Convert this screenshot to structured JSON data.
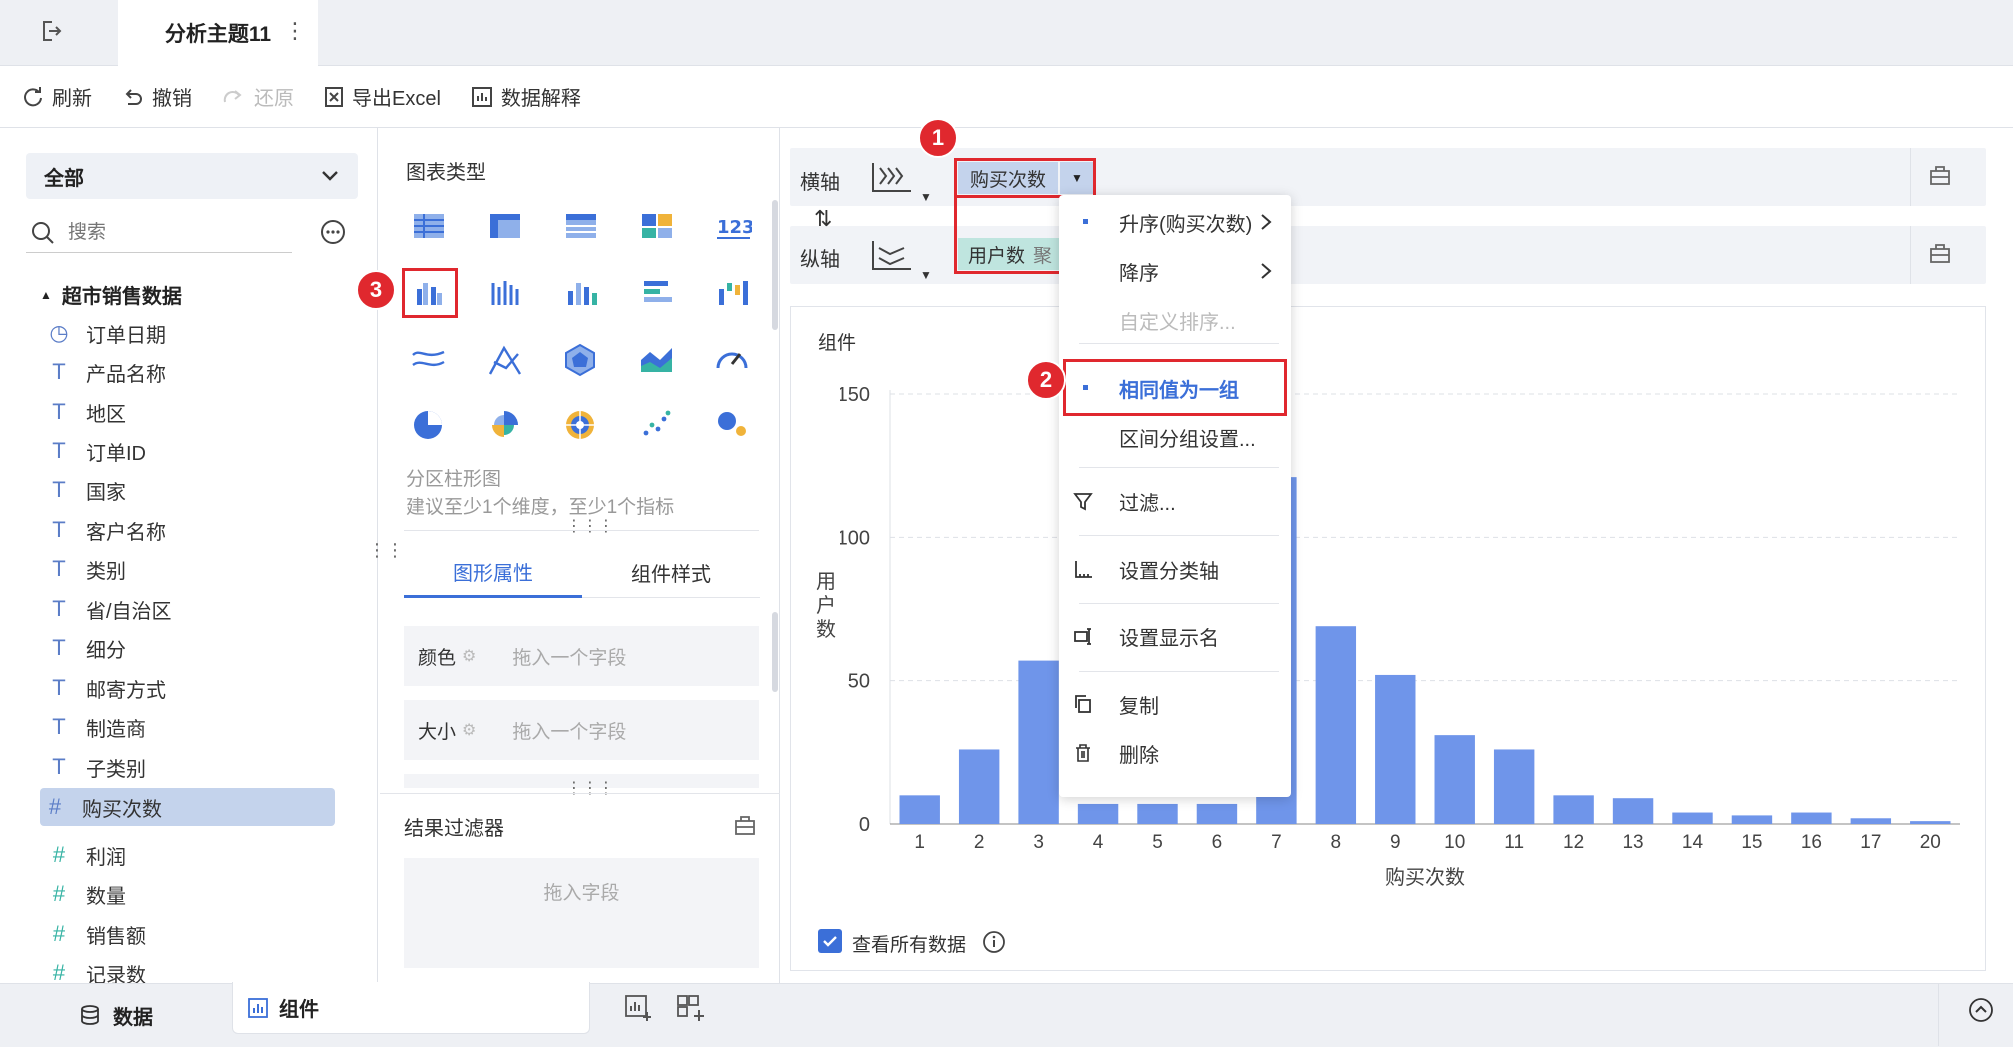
{
  "titlebar": {
    "tab_title": "分析主题11"
  },
  "toolbar": {
    "refresh": "刷新",
    "undo": "撤销",
    "redo": "还原",
    "export": "导出Excel",
    "explain": "数据解释"
  },
  "left": {
    "dataset_select": "全部",
    "search_placeholder": "搜索",
    "group_title": "超市销售数据",
    "fields": [
      {
        "label": "订单日期",
        "type": "date"
      },
      {
        "label": "产品名称",
        "type": "text"
      },
      {
        "label": "地区",
        "type": "text"
      },
      {
        "label": "订单ID",
        "type": "text"
      },
      {
        "label": "国家",
        "type": "text"
      },
      {
        "label": "客户名称",
        "type": "text"
      },
      {
        "label": "类别",
        "type": "text"
      },
      {
        "label": "省/自治区",
        "type": "text"
      },
      {
        "label": "细分",
        "type": "text"
      },
      {
        "label": "邮寄方式",
        "type": "text"
      },
      {
        "label": "制造商",
        "type": "text"
      },
      {
        "label": "子类别",
        "type": "text"
      },
      {
        "label": "购买次数",
        "type": "num-dim",
        "selected": true
      },
      {
        "label": "利润",
        "type": "num"
      },
      {
        "label": "数量",
        "type": "num"
      },
      {
        "label": "销售额",
        "type": "num"
      },
      {
        "label": "记录数",
        "type": "num"
      }
    ]
  },
  "middle": {
    "chart_types_title": "图表类型",
    "chart_hint_name": "分区柱形图",
    "chart_hint_desc": "建议至少1个维度，至少1个指标",
    "tabs": {
      "graph_props": "图形属性",
      "component_style": "组件样式"
    },
    "props": {
      "color": "颜色",
      "size": "大小",
      "drop_placeholder": "拖入一个字段"
    },
    "result_filter": "结果过滤器",
    "drop_field": "拖入字段"
  },
  "axis": {
    "x_label": "横轴",
    "y_label": "纵轴",
    "x_field": "购买次数",
    "y_field": "用户数",
    "y_field_suffix": "聚"
  },
  "menu": {
    "items": [
      "升序(购买次数)",
      "降序",
      "自定义排序...",
      "相同值为一组",
      "区间分组设置...",
      "过滤...",
      "设置分类轴",
      "设置显示名",
      "复制",
      "删除"
    ]
  },
  "badges": [
    "1",
    "2",
    "3"
  ],
  "chart_panel": {
    "title": "组件",
    "view_all": "查看所有数据",
    "view_all_checked": true
  },
  "chart_data": {
    "type": "bar",
    "xlabel": "购买次数",
    "ylabel": "用户数",
    "ylim": [
      0,
      150
    ],
    "yticks": [
      0,
      50,
      100,
      150
    ],
    "categories": [
      "1",
      "2",
      "3",
      "4",
      "5",
      "6",
      "7",
      "8",
      "9",
      "10",
      "11",
      "12",
      "13",
      "14",
      "15",
      "16",
      "17",
      "20"
    ],
    "values": [
      10,
      26,
      57,
      7,
      7,
      7,
      121,
      69,
      52,
      31,
      26,
      10,
      9,
      4,
      3,
      4,
      2,
      1
    ],
    "color": "#6f95ea"
  },
  "bottom": {
    "data_tab": "数据",
    "component_tab": "组件"
  }
}
